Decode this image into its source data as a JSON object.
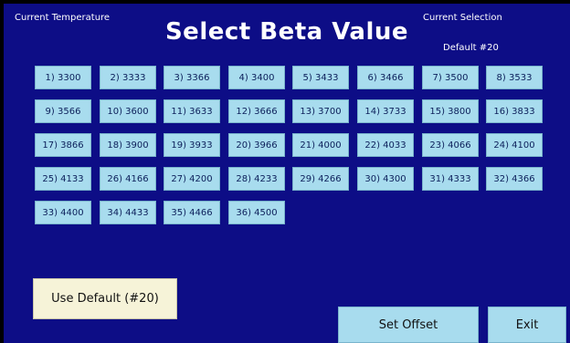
{
  "header": {
    "current_temperature_label": "Current Temperature",
    "title": "Select Beta Value",
    "current_selection_label": "Current Selection",
    "current_selection_value": "Default #20"
  },
  "beta_values": [
    "1) 3300",
    "2) 3333",
    "3) 3366",
    "4) 3400",
    "5) 3433",
    "6) 3466",
    "7) 3500",
    "8) 3533",
    "9) 3566",
    "10) 3600",
    "11) 3633",
    "12) 3666",
    "13) 3700",
    "14) 3733",
    "15) 3800",
    "16) 3833",
    "17) 3866",
    "18) 3900",
    "19) 3933",
    "20) 3966",
    "21) 4000",
    "22) 4033",
    "23) 4066",
    "24) 4100",
    "25) 4133",
    "26) 4166",
    "27) 4200",
    "28) 4233",
    "29) 4266",
    "30) 4300",
    "31) 4333",
    "32) 4366",
    "33) 4400",
    "34) 4433",
    "35) 4466",
    "36) 4500"
  ],
  "footer": {
    "use_default_label": "Use Default (#20)",
    "set_offset_label": "Set Offset",
    "exit_label": "Exit"
  },
  "colors": {
    "background": "#0d0d86",
    "button": "#a8dcee",
    "default_button": "#f6f3d8",
    "text_light": "#ffffff"
  }
}
